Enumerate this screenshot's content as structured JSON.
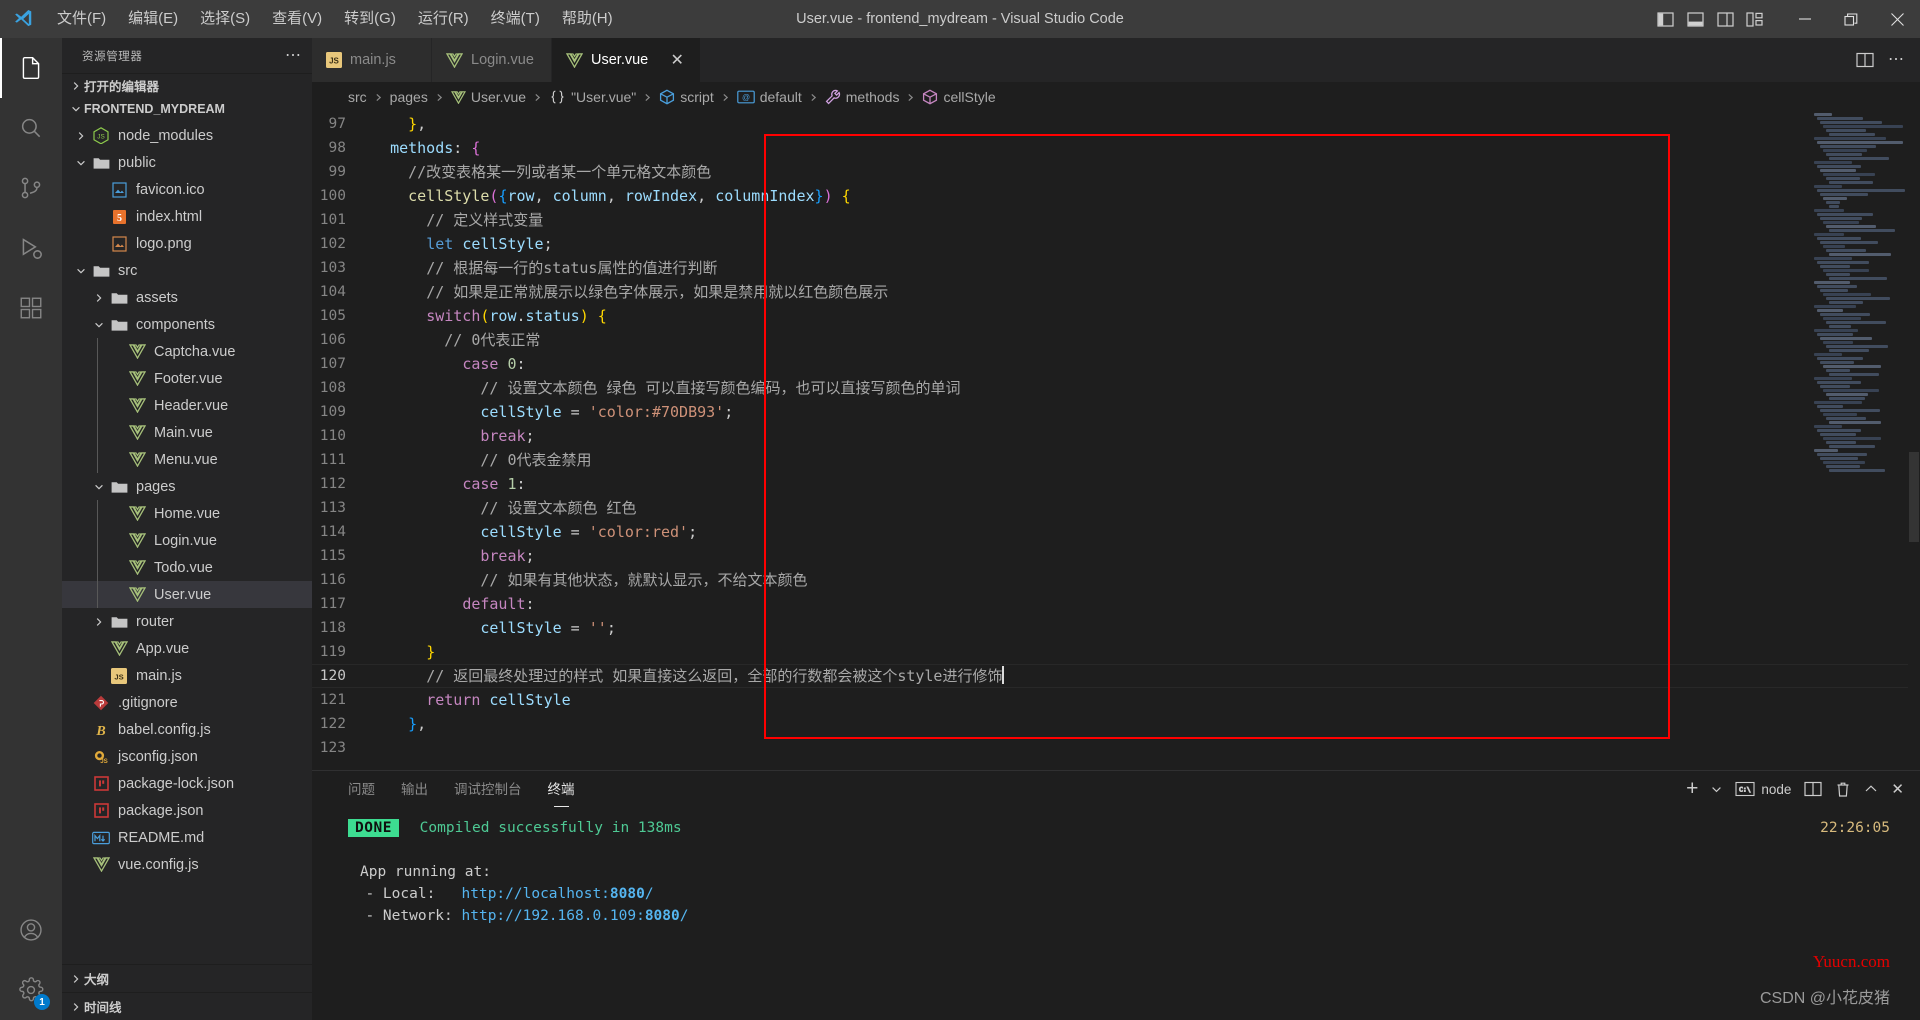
{
  "window": {
    "title": "User.vue - frontend_mydream - Visual Studio Code",
    "menus": [
      "文件(F)",
      "编辑(E)",
      "选择(S)",
      "查看(V)",
      "转到(G)",
      "运行(R)",
      "终端(T)",
      "帮助(H)"
    ],
    "controls": {
      "minimize": "—",
      "restore": "❐",
      "close": "✕"
    },
    "layout_icons": [
      "panel-left-icon",
      "panel-bottom-icon",
      "panel-right-icon",
      "customize-layout-icon"
    ]
  },
  "activitybar": {
    "items": [
      {
        "name": "explorer",
        "icon": "files-icon",
        "active": true
      },
      {
        "name": "search",
        "icon": "search-icon",
        "active": false
      },
      {
        "name": "source-control",
        "icon": "source-control-icon",
        "active": false
      },
      {
        "name": "run-debug",
        "icon": "run-debug-icon",
        "active": false
      },
      {
        "name": "extensions",
        "icon": "extensions-icon",
        "active": false
      },
      {
        "name": "accounts",
        "icon": "account-icon",
        "active": false
      },
      {
        "name": "settings",
        "icon": "gear-icon",
        "active": false,
        "badge": "1"
      }
    ]
  },
  "sidebar": {
    "header": "资源管理器",
    "open_editors_label": "打开的编辑器",
    "project_label": "FRONTEND_MYDREAM",
    "tree": [
      {
        "label": "node_modules",
        "depth": 1,
        "type": "folder",
        "expanded": false,
        "icon": "nodejs-icon"
      },
      {
        "label": "public",
        "depth": 1,
        "type": "folder",
        "expanded": true,
        "icon": "folder-icon"
      },
      {
        "label": "favicon.ico",
        "depth": 2,
        "type": "file",
        "icon": "image-icon-blue"
      },
      {
        "label": "index.html",
        "depth": 2,
        "type": "file",
        "icon": "html-icon"
      },
      {
        "label": "logo.png",
        "depth": 2,
        "type": "file",
        "icon": "image-icon-orange"
      },
      {
        "label": "src",
        "depth": 1,
        "type": "folder",
        "expanded": true,
        "icon": "folder-icon"
      },
      {
        "label": "assets",
        "depth": 2,
        "type": "folder",
        "expanded": false,
        "icon": "folder-icon"
      },
      {
        "label": "components",
        "depth": 2,
        "type": "folder",
        "expanded": true,
        "icon": "folder-icon"
      },
      {
        "label": "Captcha.vue",
        "depth": 3,
        "type": "file",
        "icon": "vue-icon"
      },
      {
        "label": "Footer.vue",
        "depth": 3,
        "type": "file",
        "icon": "vue-icon"
      },
      {
        "label": "Header.vue",
        "depth": 3,
        "type": "file",
        "icon": "vue-icon"
      },
      {
        "label": "Main.vue",
        "depth": 3,
        "type": "file",
        "icon": "vue-icon"
      },
      {
        "label": "Menu.vue",
        "depth": 3,
        "type": "file",
        "icon": "vue-icon"
      },
      {
        "label": "pages",
        "depth": 2,
        "type": "folder",
        "expanded": true,
        "icon": "folder-icon"
      },
      {
        "label": "Home.vue",
        "depth": 3,
        "type": "file",
        "icon": "vue-icon"
      },
      {
        "label": "Login.vue",
        "depth": 3,
        "type": "file",
        "icon": "vue-icon"
      },
      {
        "label": "Todo.vue",
        "depth": 3,
        "type": "file",
        "icon": "vue-icon"
      },
      {
        "label": "User.vue",
        "depth": 3,
        "type": "file",
        "icon": "vue-icon",
        "selected": true
      },
      {
        "label": "router",
        "depth": 2,
        "type": "folder",
        "expanded": false,
        "icon": "folder-icon"
      },
      {
        "label": "App.vue",
        "depth": 2,
        "type": "file",
        "icon": "vue-icon"
      },
      {
        "label": "main.js",
        "depth": 2,
        "type": "file",
        "icon": "js-icon"
      },
      {
        "label": ".gitignore",
        "depth": 1,
        "type": "file",
        "icon": "git-icon"
      },
      {
        "label": "babel.config.js",
        "depth": 1,
        "type": "file",
        "icon": "babel-icon"
      },
      {
        "label": "jsconfig.json",
        "depth": 1,
        "type": "file",
        "icon": "jsconfig-icon"
      },
      {
        "label": "package-lock.json",
        "depth": 1,
        "type": "file",
        "icon": "npm-icon"
      },
      {
        "label": "package.json",
        "depth": 1,
        "type": "file",
        "icon": "npm-icon"
      },
      {
        "label": "README.md",
        "depth": 1,
        "type": "file",
        "icon": "markdown-icon"
      },
      {
        "label": "vue.config.js",
        "depth": 1,
        "type": "file",
        "icon": "vue-icon"
      }
    ],
    "bottom_sections": [
      "大纲",
      "时间线"
    ]
  },
  "tabs": [
    {
      "label": "main.js",
      "icon": "js-icon",
      "active": false,
      "dirty": false
    },
    {
      "label": "Login.vue",
      "icon": "vue-icon",
      "active": false,
      "dirty": false
    },
    {
      "label": "User.vue",
      "icon": "vue-icon",
      "active": true,
      "dirty": false,
      "close": "✕"
    }
  ],
  "breadcrumb": [
    {
      "label": "src",
      "icon": ""
    },
    {
      "label": "pages",
      "icon": ""
    },
    {
      "label": "User.vue",
      "icon": "vue-icon"
    },
    {
      "label": "\"User.vue\"",
      "icon": "braces-icon"
    },
    {
      "label": "script",
      "icon": "cube-icon-blue"
    },
    {
      "label": "default",
      "icon": "symbol-icon"
    },
    {
      "label": "methods",
      "icon": "wrench-icon"
    },
    {
      "label": "cellStyle",
      "icon": "cube-icon-purple"
    }
  ],
  "editor": {
    "first_line": 97,
    "cursor_line": 120,
    "lines": [
      {
        "n": 97,
        "tokens": [
          {
            "t": "    ",
            "c": "t-pun"
          },
          {
            "t": "}",
            "c": "t-y"
          },
          {
            "t": ",",
            "c": "t-pun"
          }
        ]
      },
      {
        "n": 98,
        "tokens": [
          {
            "t": "  ",
            "c": "t-pun"
          },
          {
            "t": "methods",
            "c": "t-var"
          },
          {
            "t": ": ",
            "c": "t-pun"
          },
          {
            "t": "{",
            "c": "t-p"
          }
        ]
      },
      {
        "n": 99,
        "tokens": [
          {
            "t": "    ",
            "c": "t-pun"
          },
          {
            "t": "//改变表格某一列或者某一个单元格文本颜色",
            "c": "t-cmt2"
          }
        ]
      },
      {
        "n": 100,
        "tokens": [
          {
            "t": "    ",
            "c": "t-pun"
          },
          {
            "t": "cellStyle",
            "c": "t-fn"
          },
          {
            "t": "(",
            "c": "t-p"
          },
          {
            "t": "{",
            "c": "t-b"
          },
          {
            "t": "row",
            "c": "t-var"
          },
          {
            "t": ", ",
            "c": "t-pun"
          },
          {
            "t": "column",
            "c": "t-var"
          },
          {
            "t": ", ",
            "c": "t-pun"
          },
          {
            "t": "rowIndex",
            "c": "t-var"
          },
          {
            "t": ", ",
            "c": "t-pun"
          },
          {
            "t": "columnIndex",
            "c": "t-var"
          },
          {
            "t": "}",
            "c": "t-b"
          },
          {
            "t": ")",
            "c": "t-p"
          },
          {
            "t": " ",
            "c": "t-pun"
          },
          {
            "t": "{",
            "c": "t-y"
          }
        ]
      },
      {
        "n": 101,
        "tokens": [
          {
            "t": "      ",
            "c": "t-pun"
          },
          {
            "t": "// 定义样式变量",
            "c": "t-cmt2"
          }
        ]
      },
      {
        "n": 102,
        "tokens": [
          {
            "t": "      ",
            "c": "t-pun"
          },
          {
            "t": "let",
            "c": "t-kw2"
          },
          {
            "t": " ",
            "c": "t-pun"
          },
          {
            "t": "cellStyle",
            "c": "t-var"
          },
          {
            "t": ";",
            "c": "t-pun"
          }
        ]
      },
      {
        "n": 103,
        "tokens": [
          {
            "t": "      ",
            "c": "t-pun"
          },
          {
            "t": "// 根据每一行的status属性的值进行判断",
            "c": "t-cmt2"
          }
        ]
      },
      {
        "n": 104,
        "tokens": [
          {
            "t": "      ",
            "c": "t-pun"
          },
          {
            "t": "// 如果是正常就展示以绿色字体展示，如果是禁用就以红色颜色展示",
            "c": "t-cmt2"
          }
        ]
      },
      {
        "n": 105,
        "tokens": [
          {
            "t": "      ",
            "c": "t-pun"
          },
          {
            "t": "switch",
            "c": "t-key"
          },
          {
            "t": "(",
            "c": "t-y"
          },
          {
            "t": "row",
            "c": "t-var"
          },
          {
            "t": ".",
            "c": "t-pun"
          },
          {
            "t": "status",
            "c": "t-prop"
          },
          {
            "t": ")",
            "c": "t-y"
          },
          {
            "t": " ",
            "c": "t-pun"
          },
          {
            "t": "{",
            "c": "t-y"
          }
        ]
      },
      {
        "n": 106,
        "tokens": [
          {
            "t": "        ",
            "c": "t-pun"
          },
          {
            "t": "// ",
            "c": "t-cmt2"
          },
          {
            "t": "0",
            "c": "t-cmt2"
          },
          {
            "t": "代表正常",
            "c": "t-cmt2"
          }
        ]
      },
      {
        "n": 107,
        "tokens": [
          {
            "t": "          ",
            "c": "t-pun"
          },
          {
            "t": "case",
            "c": "t-key"
          },
          {
            "t": " ",
            "c": "t-pun"
          },
          {
            "t": "0",
            "c": "t-num"
          },
          {
            "t": ":",
            "c": "t-pun"
          }
        ]
      },
      {
        "n": 108,
        "tokens": [
          {
            "t": "            ",
            "c": "t-pun"
          },
          {
            "t": "// 设置文本颜色 绿色 可以直接写颜色编码，也可以直接写颜色的单词",
            "c": "t-cmt2"
          }
        ]
      },
      {
        "n": 109,
        "tokens": [
          {
            "t": "            ",
            "c": "t-pun"
          },
          {
            "t": "cellStyle",
            "c": "t-var"
          },
          {
            "t": " = ",
            "c": "t-pun"
          },
          {
            "t": "'color:#70DB93'",
            "c": "t-str"
          },
          {
            "t": ";",
            "c": "t-pun"
          }
        ]
      },
      {
        "n": 110,
        "tokens": [
          {
            "t": "            ",
            "c": "t-pun"
          },
          {
            "t": "break",
            "c": "t-key"
          },
          {
            "t": ";",
            "c": "t-pun"
          }
        ]
      },
      {
        "n": 111,
        "tokens": [
          {
            "t": "            ",
            "c": "t-pun"
          },
          {
            "t": "// 0代表金禁用",
            "c": "t-cmt2"
          }
        ]
      },
      {
        "n": 112,
        "tokens": [
          {
            "t": "          ",
            "c": "t-pun"
          },
          {
            "t": "case",
            "c": "t-key"
          },
          {
            "t": " ",
            "c": "t-pun"
          },
          {
            "t": "1",
            "c": "t-num"
          },
          {
            "t": ":",
            "c": "t-pun"
          }
        ]
      },
      {
        "n": 113,
        "tokens": [
          {
            "t": "            ",
            "c": "t-pun"
          },
          {
            "t": "// 设置文本颜色 红色",
            "c": "t-cmt2"
          }
        ]
      },
      {
        "n": 114,
        "tokens": [
          {
            "t": "            ",
            "c": "t-pun"
          },
          {
            "t": "cellStyle",
            "c": "t-var"
          },
          {
            "t": " = ",
            "c": "t-pun"
          },
          {
            "t": "'color:red'",
            "c": "t-str"
          },
          {
            "t": ";",
            "c": "t-pun"
          }
        ]
      },
      {
        "n": 115,
        "tokens": [
          {
            "t": "            ",
            "c": "t-pun"
          },
          {
            "t": "break",
            "c": "t-key"
          },
          {
            "t": ";",
            "c": "t-pun"
          }
        ]
      },
      {
        "n": 116,
        "tokens": [
          {
            "t": "            ",
            "c": "t-pun"
          },
          {
            "t": "// 如果有其他状态，就默认显示，不给文本颜色",
            "c": "t-cmt2"
          }
        ]
      },
      {
        "n": 117,
        "tokens": [
          {
            "t": "          ",
            "c": "t-pun"
          },
          {
            "t": "default",
            "c": "t-key"
          },
          {
            "t": ":",
            "c": "t-pun"
          }
        ]
      },
      {
        "n": 118,
        "tokens": [
          {
            "t": "            ",
            "c": "t-pun"
          },
          {
            "t": "cellStyle",
            "c": "t-var"
          },
          {
            "t": " = ",
            "c": "t-pun"
          },
          {
            "t": "''",
            "c": "t-str"
          },
          {
            "t": ";",
            "c": "t-pun"
          }
        ]
      },
      {
        "n": 119,
        "tokens": [
          {
            "t": "      ",
            "c": "t-pun"
          },
          {
            "t": "}",
            "c": "t-y"
          }
        ]
      },
      {
        "n": 120,
        "tokens": [
          {
            "t": "      ",
            "c": "t-pun"
          },
          {
            "t": "// 返回最终处理过的样式 如果直接这么返回，全部的行数都会被这个style进行修饰",
            "c": "t-cmt2"
          }
        ]
      },
      {
        "n": 121,
        "tokens": [
          {
            "t": "      ",
            "c": "t-pun"
          },
          {
            "t": "return",
            "c": "t-key"
          },
          {
            "t": " ",
            "c": "t-pun"
          },
          {
            "t": "cellStyle",
            "c": "t-var"
          }
        ]
      },
      {
        "n": 122,
        "tokens": [
          {
            "t": "    ",
            "c": "t-pun"
          },
          {
            "t": "}",
            "c": "t-b"
          },
          {
            "t": ",",
            "c": "t-pun"
          }
        ]
      },
      {
        "n": 123,
        "tokens": []
      }
    ]
  },
  "panel": {
    "tabs": [
      "问题",
      "输出",
      "调试控制台",
      "终端"
    ],
    "active_tab": "终端",
    "actions": {
      "new_terminal": "+",
      "split_dropdown": "⌄",
      "shell_name": "node",
      "split": "split-terminal-icon",
      "kill": "trash-icon",
      "maximize": "chevron-up-icon",
      "close": "✕"
    },
    "terminal": {
      "done_tag": "DONE",
      "compiled_message": "Compiled successfully in 138ms",
      "running_label": "App running at:",
      "local_label": "  - Local:   ",
      "local_url_pre": "http://localhost:",
      "local_port": "8080",
      "local_url_post": "/",
      "network_label": "  - Network: ",
      "network_url_pre": "http://192.168.0.109:",
      "network_port": "8080",
      "network_url_post": "/",
      "clock": "22:26:05"
    }
  },
  "watermarks": {
    "red": "Yuucn.com",
    "gray": "CSDN @小花皮猪"
  },
  "colors": {
    "accent": "#007acc",
    "editor_bg": "#1e1e1e",
    "sidebar_bg": "#252526",
    "titlebar_bg": "#3c3c3c",
    "highlight_box": "#ff0000",
    "done_badge": "#3ddc91"
  }
}
